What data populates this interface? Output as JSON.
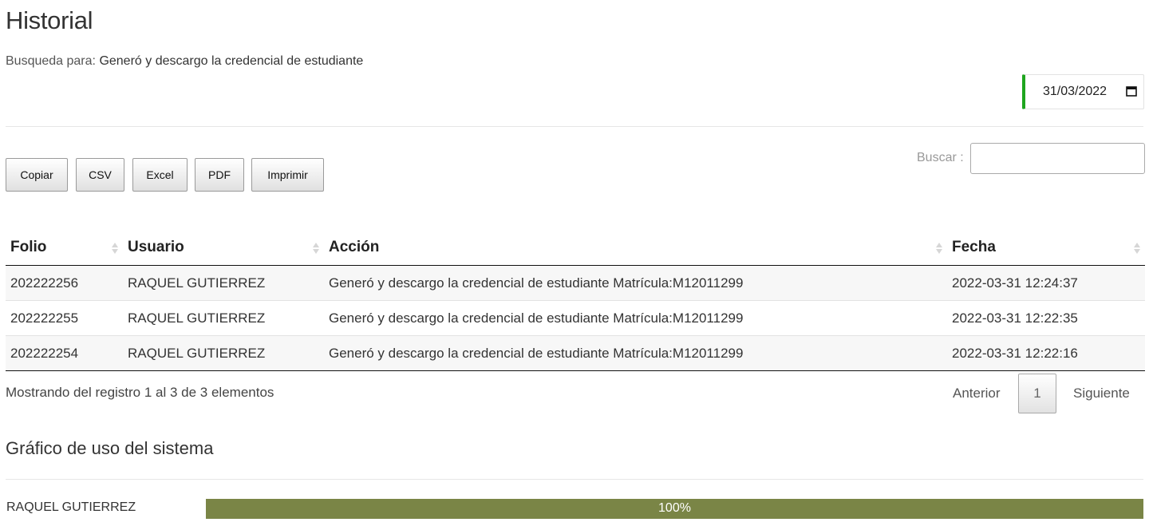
{
  "page": {
    "title": "Historial",
    "search_prefix": "Busqueda para:",
    "search_value": "Generó y descargo la credencial de estudiante",
    "date_value": "31/03/2022"
  },
  "toolbar": {
    "buttons": [
      "Copiar",
      "CSV",
      "Excel",
      "PDF",
      "Imprimir"
    ],
    "search_label": "Buscar :",
    "search_value": ""
  },
  "table": {
    "columns": [
      "Folio",
      "Usuario",
      "Acción",
      "Fecha"
    ],
    "rows": [
      [
        "202222256",
        "RAQUEL GUTIERREZ",
        "Generó y descargo la credencial de estudiante Matrícula:M12011299",
        "2022-03-31 12:24:37"
      ],
      [
        "202222255",
        "RAQUEL GUTIERREZ",
        "Generó y descargo la credencial de estudiante Matrícula:M12011299",
        "2022-03-31 12:22:35"
      ],
      [
        "202222254",
        "RAQUEL GUTIERREZ",
        "Generó y descargo la credencial de estudiante Matrícula:M12011299",
        "2022-03-31 12:22:16"
      ]
    ]
  },
  "footer": {
    "info": "Mostrando del registro 1 al 3 de 3 elementos",
    "prev": "Anterior",
    "page": "1",
    "next": "Siguiente"
  },
  "usage_chart": {
    "title": "Gráfico de uso del sistema",
    "bars": [
      {
        "label": "RAQUEL GUTIERREZ",
        "percent": 100,
        "text": "100%"
      }
    ],
    "bar_color": "#7a8546"
  },
  "colors": {
    "accent_green": "#1ea51e",
    "user_link": "#b5876a"
  }
}
